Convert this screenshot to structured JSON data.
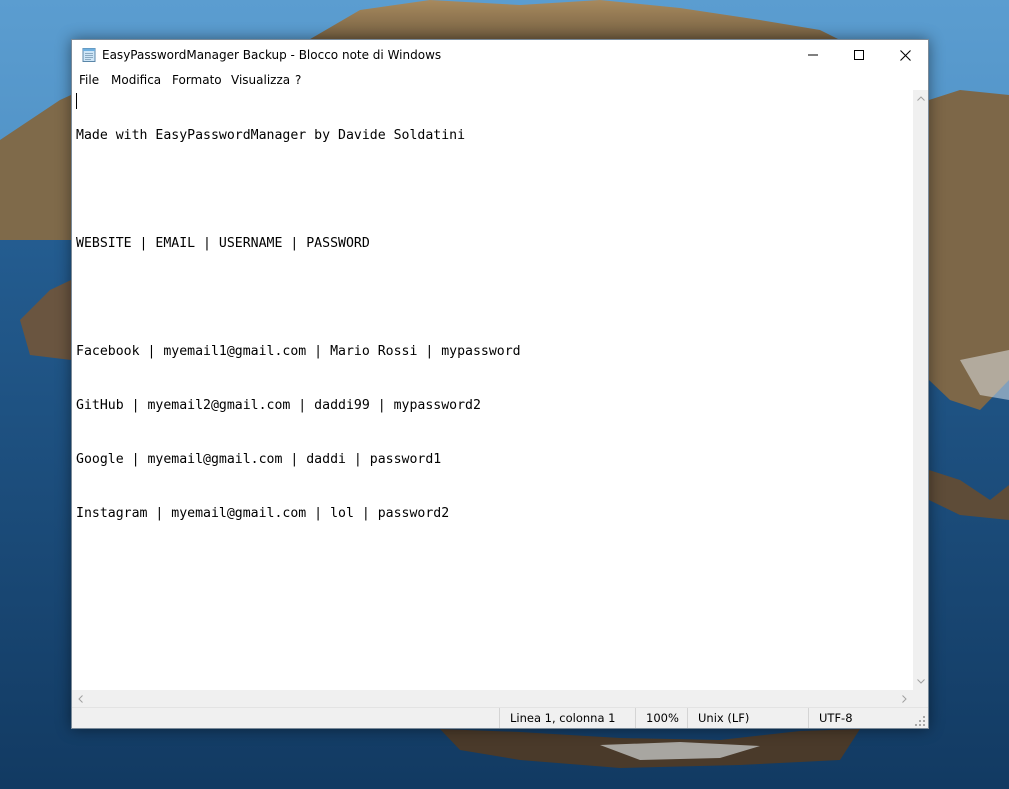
{
  "window": {
    "title": "EasyPasswordManager Backup - Blocco note di Windows",
    "app_icon": "notepad-icon",
    "controls": {
      "minimize_icon": "minimize-icon",
      "maximize_icon": "maximize-icon",
      "close_icon": "close-icon"
    }
  },
  "menu": {
    "items": [
      {
        "label": "File"
      },
      {
        "label": "Modifica"
      },
      {
        "label": "Formato"
      },
      {
        "label": "Visualizza"
      },
      {
        "label": "?"
      }
    ]
  },
  "editor": {
    "lines": [
      "Made with EasyPasswordManager by Davide Soldatini",
      "",
      "WEBSITE | EMAIL | USERNAME | PASSWORD",
      "",
      "Facebook | myemail1@gmail.com | Mario Rossi | mypassword",
      "GitHub | myemail2@gmail.com | daddi99 | mypassword2",
      "Google | myemail@gmail.com | daddi | password1",
      "Instagram | myemail@gmail.com | lol | password2"
    ]
  },
  "statusbar": {
    "position": "Linea 1, colonna 1",
    "zoom": "100%",
    "line_ending": "Unix (LF)",
    "encoding": "UTF-8"
  },
  "colors": {
    "sky": "#3d7fb3",
    "sea": "#1b4a78",
    "cliff": "#8a6a4a",
    "window_bg": "#ffffff",
    "chrome_gray": "#f0f0f0"
  }
}
